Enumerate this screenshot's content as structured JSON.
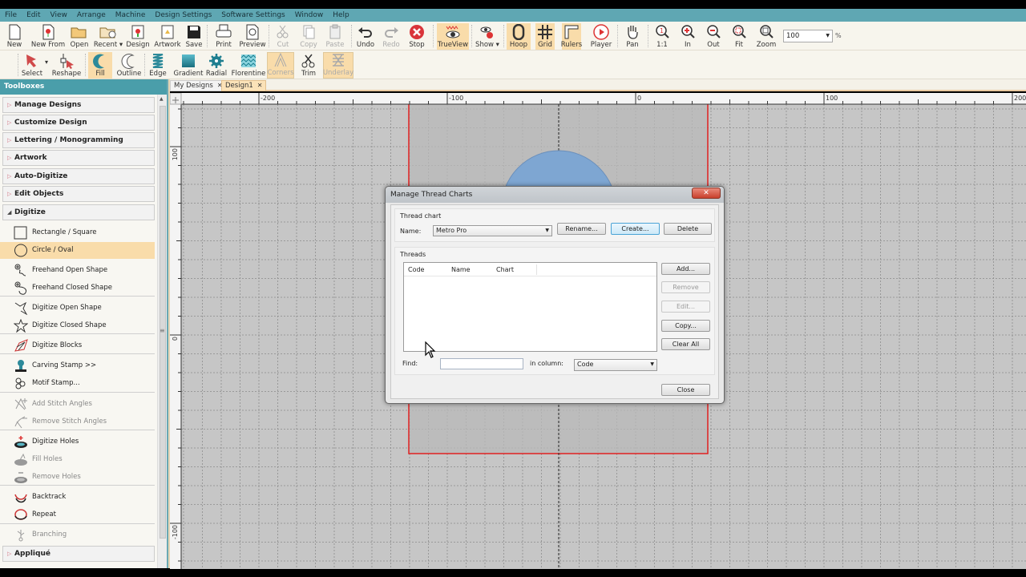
{
  "menu": [
    "File",
    "Edit",
    "View",
    "Arrange",
    "Machine",
    "Design Settings",
    "Software Settings",
    "Window",
    "Help"
  ],
  "toolbar1": [
    {
      "id": "new",
      "label": "New",
      "icon": "new-file-icon",
      "state": "normal"
    },
    {
      "id": "new-from",
      "label": "New From",
      "icon": "new-from-icon",
      "state": "normal"
    },
    {
      "id": "open",
      "label": "Open",
      "icon": "open-folder-icon",
      "state": "normal"
    },
    {
      "id": "recent",
      "label": "Recent ▾",
      "icon": "recent-folder-icon",
      "state": "normal"
    },
    {
      "id": "design",
      "label": "Design",
      "icon": "design-icon",
      "state": "normal"
    },
    {
      "id": "artwork",
      "label": "Artwork",
      "icon": "artwork-icon",
      "state": "normal"
    },
    {
      "id": "save",
      "label": "Save",
      "icon": "save-icon",
      "state": "normal"
    },
    {
      "id": "print",
      "label": "Print",
      "icon": "print-icon",
      "state": "normal"
    },
    {
      "id": "preview",
      "label": "Preview",
      "icon": "preview-icon",
      "state": "normal"
    },
    {
      "id": "cut",
      "label": "Cut",
      "icon": "cut-icon",
      "state": "disabled"
    },
    {
      "id": "copy",
      "label": "Copy",
      "icon": "copy-icon",
      "state": "disabled"
    },
    {
      "id": "paste",
      "label": "Paste",
      "icon": "paste-icon",
      "state": "disabled"
    },
    {
      "id": "undo",
      "label": "Undo",
      "icon": "undo-icon",
      "state": "normal"
    },
    {
      "id": "redo",
      "label": "Redo",
      "icon": "redo-icon",
      "state": "disabled"
    },
    {
      "id": "stop",
      "label": "Stop",
      "icon": "stop-icon",
      "state": "normal"
    },
    {
      "id": "trueview",
      "label": "TrueView",
      "icon": "trueview-icon",
      "state": "active"
    },
    {
      "id": "show",
      "label": "Show ▾",
      "icon": "show-icon",
      "state": "normal"
    },
    {
      "id": "hoop",
      "label": "Hoop",
      "icon": "hoop-icon",
      "state": "active"
    },
    {
      "id": "grid",
      "label": "Grid",
      "icon": "grid-icon",
      "state": "active"
    },
    {
      "id": "rulers",
      "label": "Rulers",
      "icon": "rulers-icon",
      "state": "active"
    },
    {
      "id": "player",
      "label": "Player",
      "icon": "player-icon",
      "state": "normal"
    },
    {
      "id": "pan",
      "label": "Pan",
      "icon": "pan-hand-icon",
      "state": "normal"
    },
    {
      "id": "zoom-1-1",
      "label": "1:1",
      "icon": "zoom-actual-icon",
      "state": "normal"
    },
    {
      "id": "zoom-in",
      "label": "In",
      "icon": "zoom-in-icon",
      "state": "normal"
    },
    {
      "id": "zoom-out",
      "label": "Out",
      "icon": "zoom-out-icon",
      "state": "normal"
    },
    {
      "id": "zoom-fit",
      "label": "Fit",
      "icon": "zoom-fit-icon",
      "state": "normal"
    },
    {
      "id": "zoom",
      "label": "Zoom",
      "icon": "zoom-box-icon",
      "state": "normal"
    }
  ],
  "zoom_value": "100",
  "zoom_unit": "%",
  "toolbar2": [
    {
      "id": "select",
      "label": "Select",
      "icon": "select-arrow-icon",
      "state": "normal"
    },
    {
      "id": "reshape",
      "label": "Reshape",
      "icon": "reshape-icon",
      "state": "normal"
    },
    {
      "id": "fill",
      "label": "Fill",
      "icon": "fill-icon",
      "state": "active"
    },
    {
      "id": "outline",
      "label": "Outline",
      "icon": "outline-icon",
      "state": "normal"
    },
    {
      "id": "edge",
      "label": "Edge",
      "icon": "edge-icon",
      "state": "normal"
    },
    {
      "id": "gradient",
      "label": "Gradient",
      "icon": "gradient-icon",
      "state": "normal"
    },
    {
      "id": "radial",
      "label": "Radial",
      "icon": "radial-icon",
      "state": "normal"
    },
    {
      "id": "florentine",
      "label": "Florentine",
      "icon": "florentine-icon",
      "state": "normal"
    },
    {
      "id": "corners",
      "label": "Corners",
      "icon": "corners-icon",
      "state": "active-disabled"
    },
    {
      "id": "trim",
      "label": "Trim",
      "icon": "trim-icon",
      "state": "normal"
    },
    {
      "id": "underlay",
      "label": "Underlay",
      "icon": "underlay-icon",
      "state": "active-disabled"
    }
  ],
  "sidebar": {
    "title": "Toolboxes",
    "sections": [
      {
        "label": "Manage Designs",
        "open": false
      },
      {
        "label": "Customize Design",
        "open": false
      },
      {
        "label": "Lettering / Monogramming",
        "open": false
      },
      {
        "label": "Artwork",
        "open": false
      },
      {
        "label": "Auto-Digitize",
        "open": false
      },
      {
        "label": "Edit Objects",
        "open": false
      },
      {
        "label": "Digitize",
        "open": true
      }
    ],
    "digitize_items": [
      {
        "label": "Rectangle / Square",
        "icon": "rectangle-icon",
        "state": "normal"
      },
      {
        "label": "Circle / Oval",
        "icon": "circle-icon",
        "state": "selected"
      },
      {
        "label": "Freehand Open Shape",
        "icon": "freehand-open-icon",
        "state": "normal"
      },
      {
        "label": "Freehand Closed Shape",
        "icon": "freehand-closed-icon",
        "state": "normal"
      },
      {
        "label": "Digitize Open Shape",
        "icon": "open-star-icon",
        "state": "normal"
      },
      {
        "label": "Digitize Closed Shape",
        "icon": "closed-star-icon",
        "state": "normal"
      },
      {
        "label": "Digitize Blocks",
        "icon": "blocks-icon",
        "state": "normal"
      },
      {
        "label": "Carving Stamp >>",
        "icon": "carving-stamp-icon",
        "state": "normal"
      },
      {
        "label": "Motif Stamp...",
        "icon": "motif-stamp-icon",
        "state": "normal"
      },
      {
        "label": "Add Stitch Angles",
        "icon": "add-stitch-angles-icon",
        "state": "disabled"
      },
      {
        "label": "Remove Stitch Angles",
        "icon": "remove-stitch-angles-icon",
        "state": "disabled"
      },
      {
        "label": "Digitize Holes",
        "icon": "digitize-holes-icon",
        "state": "normal"
      },
      {
        "label": "Fill Holes",
        "icon": "fill-holes-icon",
        "state": "disabled"
      },
      {
        "label": "Remove Holes",
        "icon": "remove-holes-icon",
        "state": "disabled"
      },
      {
        "label": "Backtrack",
        "icon": "backtrack-icon",
        "state": "normal"
      },
      {
        "label": "Repeat",
        "icon": "repeat-icon",
        "state": "normal"
      },
      {
        "label": "Branching",
        "icon": "branching-icon",
        "state": "disabled"
      }
    ],
    "after_section": {
      "label": "Appliqué",
      "open": false
    }
  },
  "tabs": [
    {
      "label": "My Designs",
      "active": false
    },
    {
      "label": "Design1",
      "active": true
    }
  ],
  "rulers": {
    "h_labels": [
      "-200",
      "-100",
      "0",
      "100",
      "200"
    ],
    "v_labels": [
      "100",
      "0",
      "-100"
    ]
  },
  "dialog": {
    "title": "Manage Thread Charts",
    "close_x": "✕",
    "thread_chart_group": "Thread chart",
    "name_label": "Name:",
    "name_value": "Metro Pro",
    "rename": "Rename...",
    "create": "Create...",
    "delete": "Delete",
    "threads_group": "Threads",
    "columns": [
      "Code",
      "Name",
      "Chart"
    ],
    "rows": [],
    "add": "Add...",
    "remove": "Remove",
    "edit": "Edit...",
    "copy": "Copy...",
    "clear_all": "Clear All",
    "find_label": "Find:",
    "find_value": "",
    "in_column_label": "in column:",
    "in_column_value": "Code",
    "close": "Close"
  },
  "colors": {
    "menubar": "#5fa7b3",
    "accent_active": "#f9dcaa",
    "hoop_red": "#e02020",
    "canvas": "#c8c8c8",
    "hoop_fill": "#b7b7b7",
    "design_blue": "#7ea6d2"
  }
}
